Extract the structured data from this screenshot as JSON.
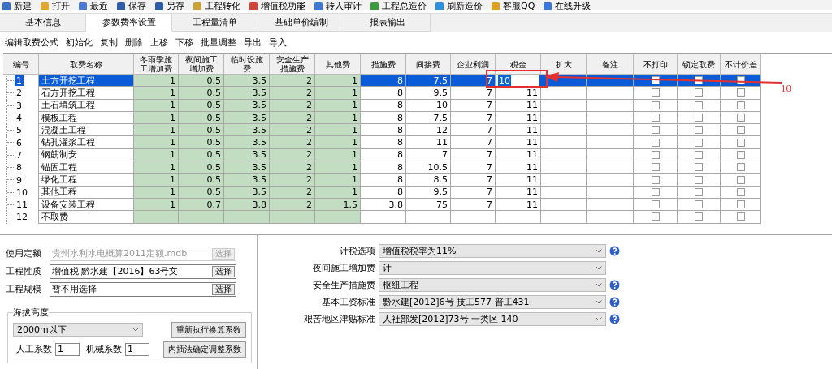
{
  "toolbar": [
    {
      "label": "新建"
    },
    {
      "label": "打开"
    },
    {
      "label": "最近"
    },
    {
      "label": "保存"
    },
    {
      "label": "另存"
    },
    {
      "label": "工程转化"
    },
    {
      "label": "增值税功能"
    },
    {
      "label": "转入审计"
    },
    {
      "label": "工程总造价"
    },
    {
      "label": "刷新造价"
    },
    {
      "label": "客服QQ"
    },
    {
      "label": "在线升级"
    }
  ],
  "tabs": [
    {
      "label": "基本信息",
      "selected": false
    },
    {
      "label": "参数费率设置",
      "selected": true
    },
    {
      "label": "工程量清单",
      "selected": false
    },
    {
      "label": "基础单价编制",
      "selected": false
    },
    {
      "label": "报表输出",
      "selected": false
    }
  ],
  "actions": [
    "编辑取费公式",
    "初始化",
    "复制",
    "删除",
    "上移",
    "下移",
    "批量调整",
    "导出",
    "导入"
  ],
  "table": {
    "columns": [
      {
        "label": "编号",
        "shaded": false
      },
      {
        "label": "取费名称",
        "shaded": false
      },
      {
        "label": "冬雨季施工增加费",
        "shaded": true
      },
      {
        "label": "夜间施工增加费",
        "shaded": true
      },
      {
        "label": "临时设施费",
        "shaded": true
      },
      {
        "label": "安全生产措施费",
        "shaded": true
      },
      {
        "label": "其他费",
        "shaded": true
      },
      {
        "label": "措施费",
        "shaded": false
      },
      {
        "label": "间接费",
        "shaded": false
      },
      {
        "label": "企业利润",
        "shaded": false
      },
      {
        "label": "税金",
        "shaded": false
      },
      {
        "label": "扩大",
        "shaded": false
      },
      {
        "label": "备注",
        "shaded": false
      }
    ],
    "check_columns": [
      "不打印",
      "锁定取费",
      "不计价差"
    ],
    "rows": [
      {
        "cells": [
          "1",
          "土方开挖工程",
          "1",
          "0.5",
          "3.5",
          "2",
          "1",
          "8",
          "7.5",
          "7",
          "10"
        ],
        "editing": true,
        "selected": true,
        "checks": [
          false,
          false,
          false
        ]
      },
      {
        "cells": [
          "2",
          "石方开挖工程",
          "1",
          "0.5",
          "3.5",
          "2",
          "1",
          "8",
          "9.5",
          "7",
          "11"
        ],
        "editing": false,
        "selected": false,
        "checks": [
          false,
          false,
          false
        ]
      },
      {
        "cells": [
          "3",
          "土石填筑工程",
          "1",
          "0.5",
          "3.5",
          "2",
          "1",
          "8",
          "10",
          "7",
          "11"
        ],
        "editing": false,
        "selected": false,
        "checks": [
          false,
          false,
          false
        ]
      },
      {
        "cells": [
          "4",
          "模板工程",
          "1",
          "0.5",
          "3.5",
          "2",
          "1",
          "8",
          "7.5",
          "7",
          "11"
        ],
        "editing": false,
        "selected": false,
        "checks": [
          false,
          false,
          false
        ]
      },
      {
        "cells": [
          "5",
          "混凝土工程",
          "1",
          "0.5",
          "3.5",
          "2",
          "1",
          "8",
          "12",
          "7",
          "11"
        ],
        "editing": false,
        "selected": false,
        "checks": [
          false,
          false,
          false
        ]
      },
      {
        "cells": [
          "6",
          "钻孔灌浆工程",
          "1",
          "0.5",
          "3.5",
          "2",
          "1",
          "8",
          "11",
          "7",
          "11"
        ],
        "editing": false,
        "selected": false,
        "checks": [
          false,
          false,
          false
        ]
      },
      {
        "cells": [
          "7",
          "钢筋制安",
          "1",
          "0.5",
          "3.5",
          "2",
          "1",
          "8",
          "7",
          "7",
          "11"
        ],
        "editing": false,
        "selected": false,
        "checks": [
          false,
          false,
          false
        ]
      },
      {
        "cells": [
          "8",
          "锚固工程",
          "1",
          "0.5",
          "3.5",
          "2",
          "1",
          "8",
          "10.5",
          "7",
          "11"
        ],
        "editing": false,
        "selected": false,
        "checks": [
          false,
          false,
          false
        ]
      },
      {
        "cells": [
          "9",
          "绿化工程",
          "1",
          "0.5",
          "3.5",
          "2",
          "1",
          "8",
          "8.5",
          "7",
          "11"
        ],
        "editing": false,
        "selected": false,
        "checks": [
          false,
          false,
          false
        ]
      },
      {
        "cells": [
          "10",
          "其他工程",
          "1",
          "0.5",
          "3.5",
          "2",
          "1",
          "8",
          "9.5",
          "7",
          "11"
        ],
        "editing": false,
        "selected": false,
        "checks": [
          false,
          false,
          false
        ]
      },
      {
        "cells": [
          "11",
          "设备安装工程",
          "1",
          "0.7",
          "3.8",
          "2",
          "1.5",
          "3.8",
          "75",
          "7",
          "11"
        ],
        "editing": false,
        "selected": false,
        "checks": [
          false,
          false,
          false
        ]
      },
      {
        "cells": [
          "12",
          "不取费"
        ],
        "editing": false,
        "selected": false,
        "checks": [
          false,
          false,
          false
        ]
      }
    ]
  },
  "annotation": {
    "label": "10"
  },
  "project": {
    "fields": [
      {
        "label": "使用定额",
        "value": "贵州水利水电概算2011定额.mdb",
        "button": "选择",
        "disabled": true
      },
      {
        "label": "工程性质",
        "value": "增值税 黔水建【2016】63号文",
        "button": "选择",
        "disabled": false
      },
      {
        "label": "工程规模",
        "value": "暂不用选择",
        "button": "选择",
        "disabled": false
      }
    ],
    "altitude": {
      "title": "海拔高度",
      "value": "2000m以下",
      "recalc_button": "重新执行换算系数",
      "labor_label": "人工系数",
      "labor_value": "1",
      "machine_label": "机械系数",
      "machine_value": "1",
      "interp_button": "内插法确定调整系数"
    }
  },
  "options": [
    {
      "label": "计税选项",
      "value": "增值税税率为11%",
      "help": true
    },
    {
      "label": "夜间施工增加费",
      "value": "计",
      "help": false
    },
    {
      "label": "安全生产措施费",
      "value": "枢纽工程",
      "help": true
    },
    {
      "label": "基本工资标准",
      "value": "黔水建[2012]6号 技工577 普工431",
      "help": true
    },
    {
      "label": "艰苦地区津贴标准",
      "value": "人社部发[2012]73号 一类区 140",
      "help": true
    }
  ]
}
